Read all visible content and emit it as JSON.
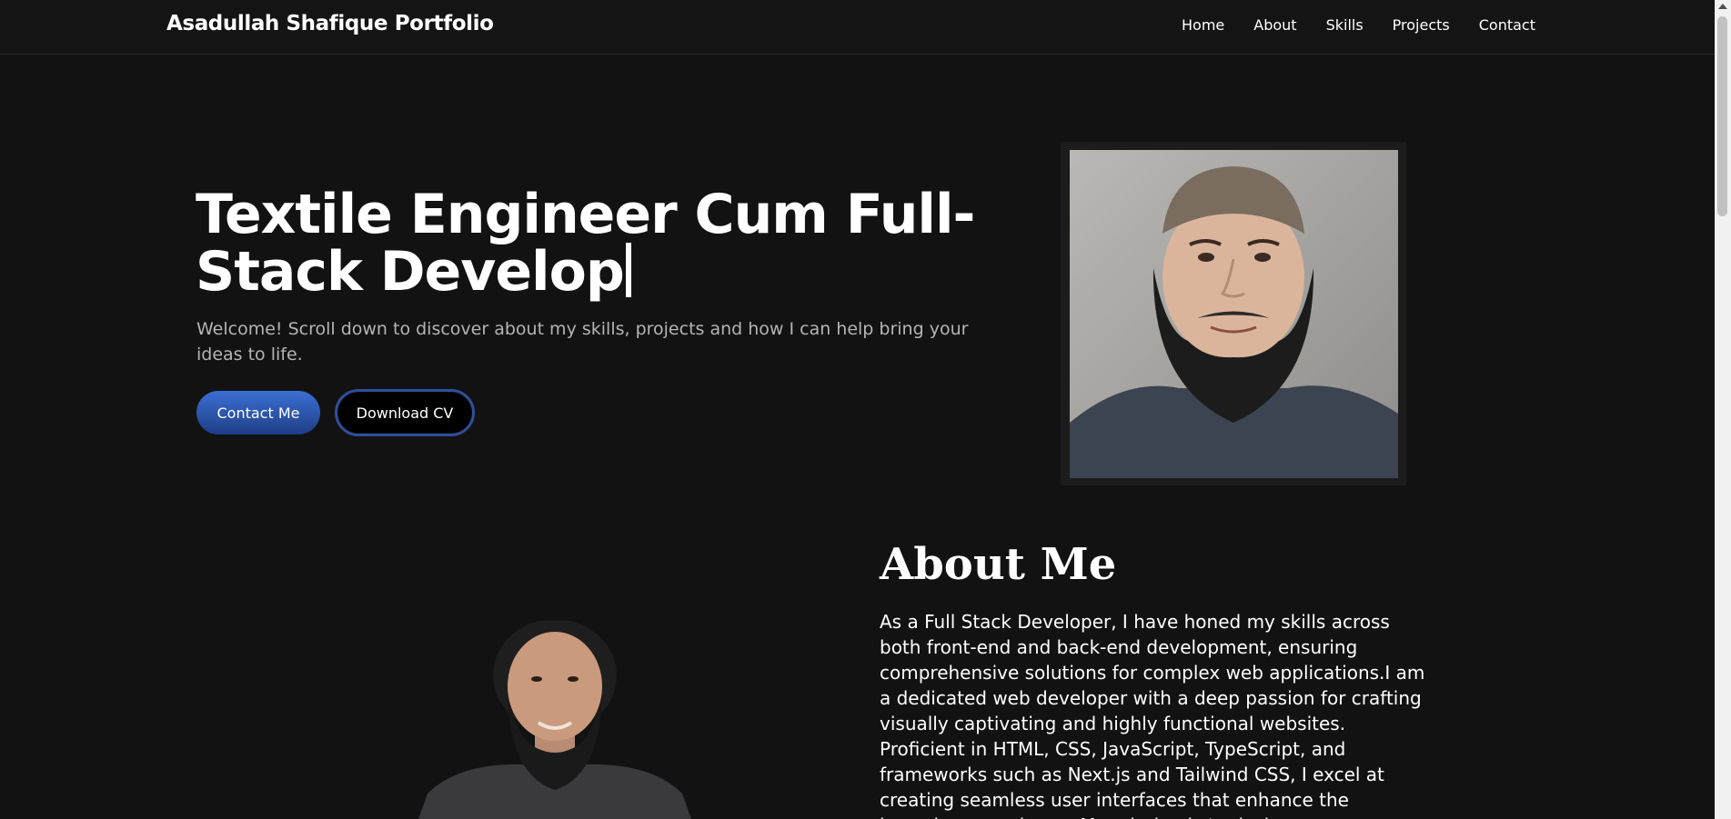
{
  "navbar": {
    "brand": "Asadullah Shafique Portfolio",
    "links": [
      "Home",
      "About",
      "Skills",
      "Projects",
      "Contact"
    ]
  },
  "hero": {
    "heading_line1": "Textile Engineer Cum Full-",
    "heading_line2": "Stack Develop",
    "subtitle": "Welcome! Scroll down to discover about my skills, projects and how I can help bring your ideas to life.",
    "contact_button": "Contact Me",
    "cv_button": "Download CV"
  },
  "about": {
    "heading": "About Me",
    "text": "As a Full Stack Developer, I have honed my skills across both front-end and back-end development, ensuring comprehensive solutions for complex web applications.I am a dedicated web developer with a deep passion for crafting visually captivating and highly functional websites. Proficient in HTML, CSS, JavaScript, TypeScript, and frameworks such as Next.js and Tailwind CSS, I excel at creating seamless user interfaces that enhance the browsing experience. My mission is to design"
  },
  "colors": {
    "background": "#121212",
    "navbar": "#141414",
    "accent_blue": "#3b6fd4",
    "muted_text": "#b4b4b4"
  }
}
